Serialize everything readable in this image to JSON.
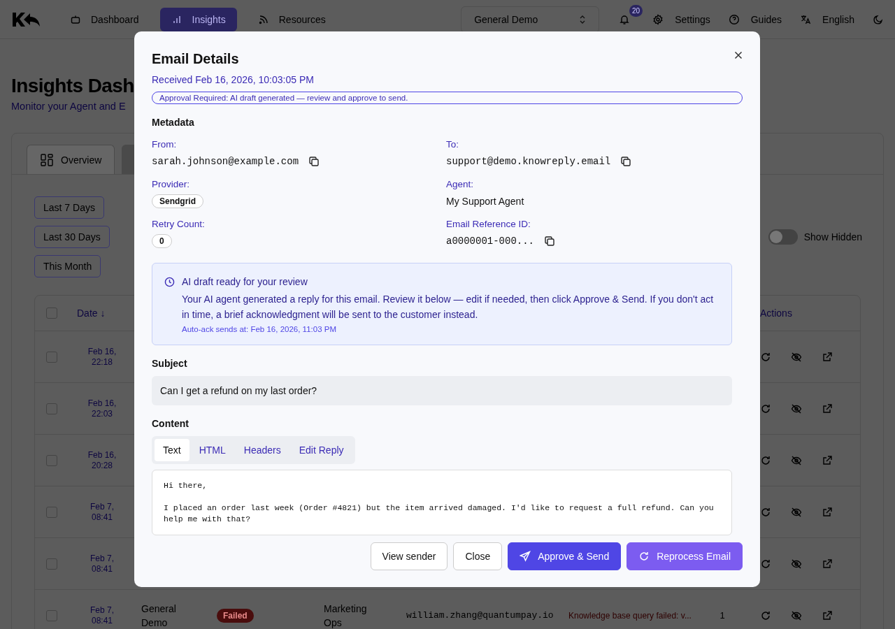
{
  "header": {
    "nav": [
      {
        "label": "Dashboard",
        "selected": false
      },
      {
        "label": "Insights",
        "selected": true
      },
      {
        "label": "Resources",
        "selected": false
      }
    ],
    "workspace": "General Demo",
    "notifications": "20",
    "links": [
      "Settings",
      "Guides",
      "English"
    ]
  },
  "page": {
    "title": "Insights Dash",
    "subtitle": "Monitor your Agent and E"
  },
  "tabs": [
    {
      "label": "Overview",
      "selected": true
    },
    {
      "selected": false
    }
  ],
  "filters": [
    "Last 7 Days",
    "Last 30 Days",
    "This Month"
  ],
  "show_hidden": {
    "label": "Show Hidden",
    "on": false
  },
  "table": {
    "date_column": "Date",
    "sort_mark": "↓",
    "actions_column": "Actions",
    "header_checked": false,
    "rows": [
      {
        "date": "Feb 16, 22:18",
        "checked": false
      },
      {
        "date": "Feb 16, 22:03",
        "checked": false
      },
      {
        "date": "Feb 16, 20:28",
        "checked": false
      },
      {
        "date": "Feb 7, 08:41",
        "checked": false
      },
      {
        "date": "Feb 7, 08:41",
        "checked": false
      },
      {
        "date": "Feb 7, 08:41",
        "checked": false,
        "workspace": "General Demo",
        "status": "Failed",
        "agent": "Marketing Ops",
        "email": "william.zhang@quantumpay.io",
        "error": "Knowledge base query failed: v...",
        "count": "1"
      }
    ]
  },
  "modal": {
    "title": "Email Details",
    "received": "Received Feb 16, 2026, 10:03:05 PM",
    "banner": "Approval Required: AI draft generated — review and approve to send.",
    "metadata_heading": "Metadata",
    "fields": [
      {
        "label": "From:",
        "value": "sarah.johnson@example.com",
        "kind": "mono",
        "copyable": true
      },
      {
        "label": "To:",
        "value": "support@demo.knowreply.email",
        "kind": "mono",
        "copyable": true
      },
      {
        "label": "Provider:",
        "value": "Sendgrid",
        "kind": "badge",
        "copyable": false
      },
      {
        "label": "Agent:",
        "value": "My Support Agent",
        "kind": "plain",
        "copyable": false
      },
      {
        "label": "Retry Count:",
        "value": "0",
        "kind": "badge",
        "copyable": false
      },
      {
        "label": "Email Reference ID:",
        "value": "a0000001-000...",
        "kind": "mono",
        "copyable": true
      }
    ],
    "notice": {
      "title": "AI draft ready for your review",
      "body": "Your AI agent generated a reply for this email. Review it below — edit if needed, then click Approve & Send. If you don't act in time, a brief acknowledgment will be sent to the customer instead.",
      "auto_ack": "Auto-ack sends at: Feb 16, 2026, 11:03 PM"
    },
    "subject_heading": "Subject",
    "subject": "Can I get a refund on my last order?",
    "content_heading": "Content",
    "content_tabs": [
      {
        "label": "Text",
        "selected": true
      },
      {
        "label": "HTML",
        "selected": false
      },
      {
        "label": "Headers",
        "selected": false
      },
      {
        "label": "Edit Reply",
        "selected": false
      }
    ],
    "content": "Hi there,\n\nI placed an order last week (Order #4821) but the item arrived damaged. I'd like to request a full refund. Can you help me with that?",
    "buttons": [
      {
        "label": "View sender",
        "kind": "outline"
      },
      {
        "label": "Close",
        "kind": "outline"
      },
      {
        "label": "Approve & Send",
        "kind": "primary"
      },
      {
        "label": "Reprocess Email",
        "kind": "secondary"
      }
    ]
  }
}
